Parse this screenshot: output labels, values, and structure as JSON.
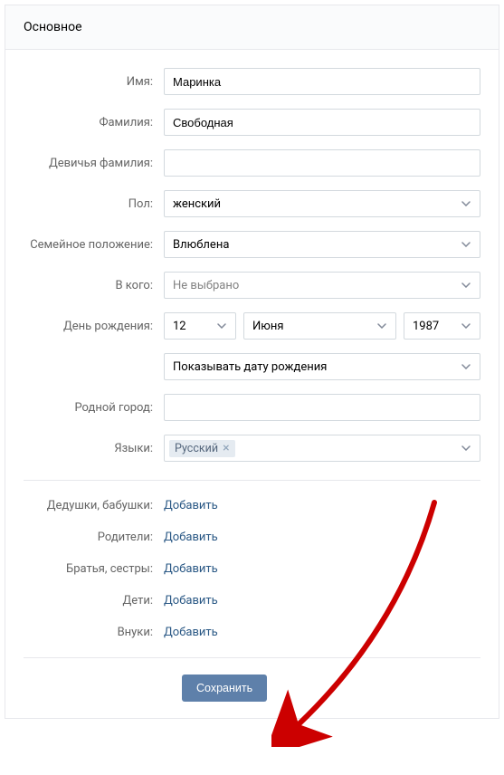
{
  "header": {
    "title": "Основное"
  },
  "fields": {
    "firstName": {
      "label": "Имя:",
      "value": "Маринка"
    },
    "lastName": {
      "label": "Фамилия:",
      "value": "Свободная"
    },
    "maidenName": {
      "label": "Девичья фамилия:",
      "value": ""
    },
    "gender": {
      "label": "Пол:",
      "value": "женский"
    },
    "relationship": {
      "label": "Семейное положение:",
      "value": "Влюблена"
    },
    "partner": {
      "label": "В кого:",
      "value": "Не выбрано"
    },
    "birthday": {
      "label": "День рождения:",
      "day": "12",
      "month": "Июня",
      "year": "1987"
    },
    "birthdayVisibility": {
      "value": "Показывать дату рождения"
    },
    "hometown": {
      "label": "Родной город:",
      "value": ""
    },
    "languages": {
      "label": "Языки:",
      "tokens": [
        "Русский"
      ]
    }
  },
  "family": {
    "grandparents": {
      "label": "Дедушки, бабушки:",
      "action": "Добавить"
    },
    "parents": {
      "label": "Родители:",
      "action": "Добавить"
    },
    "siblings": {
      "label": "Братья, сестры:",
      "action": "Добавить"
    },
    "children": {
      "label": "Дети:",
      "action": "Добавить"
    },
    "grandchildren": {
      "label": "Внуки:",
      "action": "Добавить"
    }
  },
  "footer": {
    "save": "Сохранить"
  }
}
